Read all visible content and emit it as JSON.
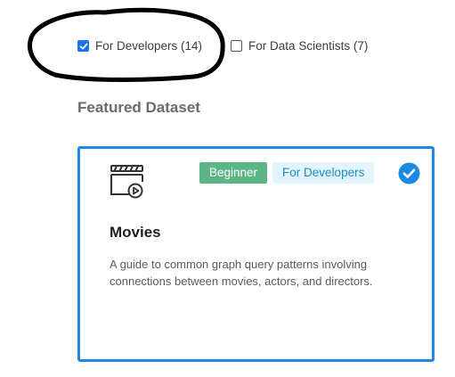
{
  "filters": [
    {
      "label": "For Developers (14)",
      "checked": true
    },
    {
      "label": "For Data Scientists (7)",
      "checked": false
    }
  ],
  "section": {
    "title": "Featured Dataset"
  },
  "card": {
    "icon": "video-library-icon",
    "badges": [
      {
        "label": "Beginner",
        "color": "#5cb585"
      },
      {
        "label": "For Developers",
        "color": "#e3f4fc"
      }
    ],
    "selected": true,
    "title": "Movies",
    "description": "A guide to common graph query patterns involving connections between movies, actors, and directors."
  },
  "colors": {
    "accent": "#1e88e5",
    "annotation": "#000000"
  }
}
